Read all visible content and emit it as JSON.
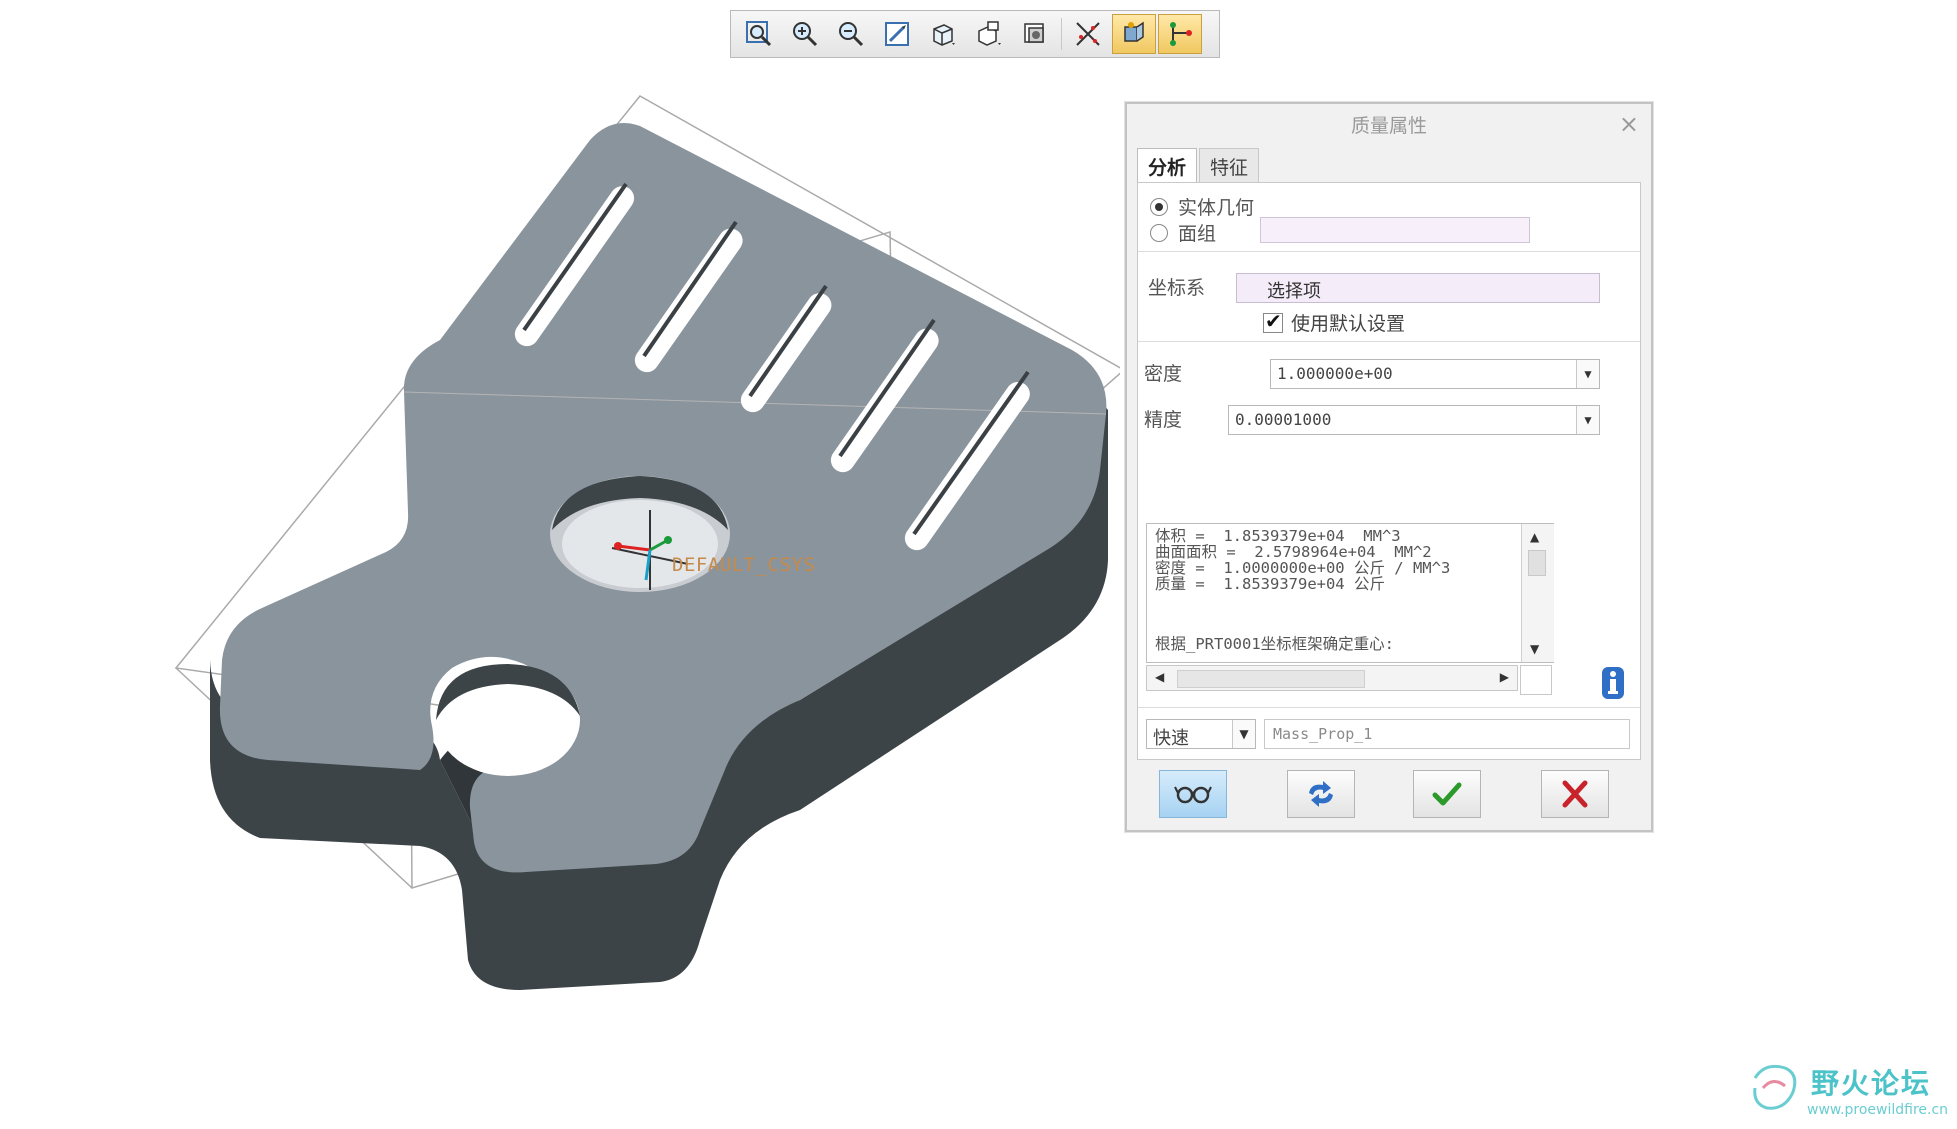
{
  "toolbar": {
    "icons": [
      "zoom-fit-icon",
      "zoom-in-icon",
      "zoom-out-icon",
      "repaint-icon",
      "display-style-icon",
      "saved-views-icon",
      "layers-icon",
      "datum-display-icon",
      "spin-center-icon",
      "annotation-display-icon"
    ]
  },
  "viewport": {
    "csys_label": "DEFAULT_CSYS"
  },
  "dialog": {
    "title": "质量属性",
    "close": "×",
    "tabs": [
      {
        "label": "分析",
        "active": true
      },
      {
        "label": "特征",
        "active": false
      }
    ],
    "geometry": {
      "solid_label": "实体几何",
      "quilt_label": "面组",
      "selected": "solid"
    },
    "csys": {
      "label": "坐标系",
      "select_value": "选择项",
      "use_default_label": "使用默认设置",
      "use_default_checked": true
    },
    "density": {
      "label": "密度",
      "value": "1.000000e+00"
    },
    "accuracy": {
      "label": "精度",
      "value": "0.00001000"
    },
    "results": {
      "text": "体积 =  1.8539379e+04  MM^3\n曲面面积 =  2.5798964e+04  MM^2\n密度 =  1.0000000e+00 公斤 / MM^3\n质量 =  1.8539379e+04 公斤",
      "note": "根据_PRT0001坐标框架确定重心:"
    },
    "mode": {
      "value": "快速"
    },
    "name_field": {
      "value": "Mass_Prop_1"
    }
  },
  "watermark": {
    "text": "野火论坛",
    "url": "www.proewildfire.cn"
  },
  "colors": {
    "part_top": "#8a949d",
    "part_side": "#3d4448",
    "csys_label": "#c68a4a",
    "ok": "#2b9a2b",
    "cancel": "#c8232a"
  }
}
